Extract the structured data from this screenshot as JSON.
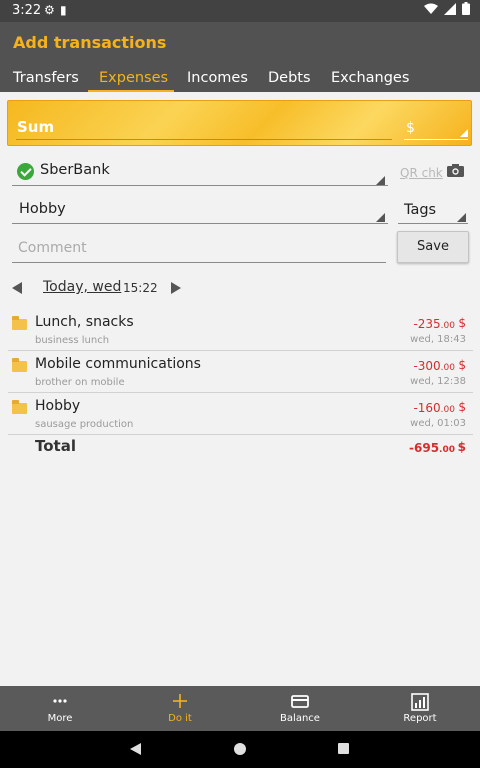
{
  "status_bar": {
    "time": "3:22"
  },
  "app_bar": {
    "title": "Add transactions",
    "tabs": [
      {
        "label": "Transfers"
      },
      {
        "label": "Expenses"
      },
      {
        "label": "Incomes"
      },
      {
        "label": "Debts"
      },
      {
        "label": "Exchanges"
      }
    ],
    "active_tab": "Expenses"
  },
  "form": {
    "sum_label": "Sum",
    "currency": "$",
    "account": "SberBank",
    "qr_link": "QR chk",
    "category": "Hobby",
    "tags_label": "Tags",
    "comment_placeholder": "Comment",
    "save_label": "Save",
    "date_label": "Today, wed",
    "time_label": "15:22"
  },
  "transactions": [
    {
      "name": "Lunch, snacks",
      "note": "business lunch",
      "amount": "-235",
      "decimals": ".00",
      "currency": "$",
      "date": "wed, 18:43"
    },
    {
      "name": "Mobile communications",
      "note": "brother on mobile",
      "amount": "-300",
      "decimals": ".00",
      "currency": "$",
      "date": "wed, 12:38"
    },
    {
      "name": "Hobby",
      "note": "sausage production",
      "amount": "-160",
      "decimals": ".00",
      "currency": "$",
      "date": "wed, 01:03"
    }
  ],
  "total": {
    "label": "Total",
    "amount": "-695",
    "decimals": ".00",
    "currency": "$"
  },
  "bottom_nav": [
    {
      "label": "More",
      "icon": "more-icon"
    },
    {
      "label": "Do it",
      "icon": "plus-icon"
    },
    {
      "label": "Balance",
      "icon": "wallet-icon"
    },
    {
      "label": "Report",
      "icon": "chart-icon"
    }
  ],
  "colors": {
    "accent": "#f6b21c",
    "expense": "#d32f2f",
    "appbar": "#525252"
  }
}
